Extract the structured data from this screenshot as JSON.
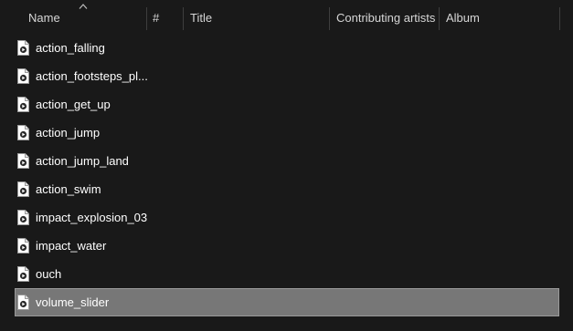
{
  "header": {
    "columns": {
      "name": "Name",
      "number": "#",
      "title": "Title",
      "contributing_artists": "Contributing artists",
      "album": "Album"
    },
    "sort_indicator_icon": "sort-ascending-arrow-icon"
  },
  "files": [
    {
      "name": "action_falling",
      "icon": "audio-file-icon",
      "selected": false
    },
    {
      "name": "action_footsteps_pl...",
      "icon": "audio-file-icon",
      "selected": false
    },
    {
      "name": "action_get_up",
      "icon": "audio-file-icon",
      "selected": false
    },
    {
      "name": "action_jump",
      "icon": "audio-file-icon",
      "selected": false
    },
    {
      "name": "action_jump_land",
      "icon": "audio-file-icon",
      "selected": false
    },
    {
      "name": "action_swim",
      "icon": "audio-file-icon",
      "selected": false
    },
    {
      "name": "impact_explosion_03",
      "icon": "audio-file-icon",
      "selected": false
    },
    {
      "name": "impact_water",
      "icon": "audio-file-icon",
      "selected": false
    },
    {
      "name": "ouch",
      "icon": "audio-file-icon",
      "selected": false
    },
    {
      "name": "volume_slider",
      "icon": "audio-file-icon",
      "selected": true
    }
  ],
  "colors": {
    "background": "#191919",
    "selection": "#777777",
    "header_text": "#d6d6d6",
    "file_text": "#ffffff"
  }
}
